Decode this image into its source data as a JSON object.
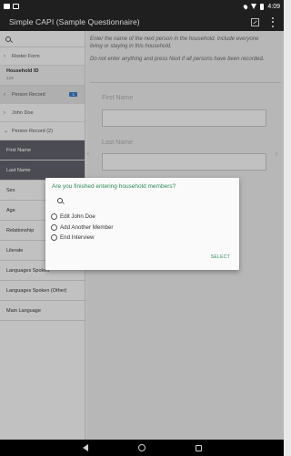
{
  "app": {
    "title": "Simple CAPI (Sample Questionnaire)",
    "status_time": "4:09"
  },
  "sidebar": {
    "tree": [
      {
        "label": "Roster Form",
        "chevron": "›"
      },
      {
        "label": "Person Record",
        "chevron": "›",
        "badge": "1"
      },
      {
        "label": "John Doe",
        "chevron": "›"
      },
      {
        "label": "Person Record (2)",
        "chevron": "⌄"
      }
    ],
    "household": {
      "label": "Household ID",
      "value": "123"
    },
    "fields": [
      "First Name",
      "Last Name",
      "Sex",
      "Age",
      "Relationship",
      "Literate",
      "Languages Spoken",
      "Languages Spoken (Other)",
      "Main Language"
    ]
  },
  "main": {
    "instruction_1": "Enter the name of the next person in the household. Include everyone living or staying in this household.",
    "instruction_2": "Do not enter anything and press Next if all persons have been recorded.",
    "first_name_label": "First Name",
    "last_name_label": "Last Name",
    "prev_arrow": "‹",
    "next_arrow": "›"
  },
  "dialog": {
    "title": "Are you finished entering household members?",
    "options": [
      "Edit John Doe",
      "Add Another Member",
      "End Interview"
    ],
    "select_label": "SELECT"
  },
  "colors": {
    "accent": "#2e8b57",
    "badge": "#3a74c4",
    "current_field": "#5c5c66"
  }
}
